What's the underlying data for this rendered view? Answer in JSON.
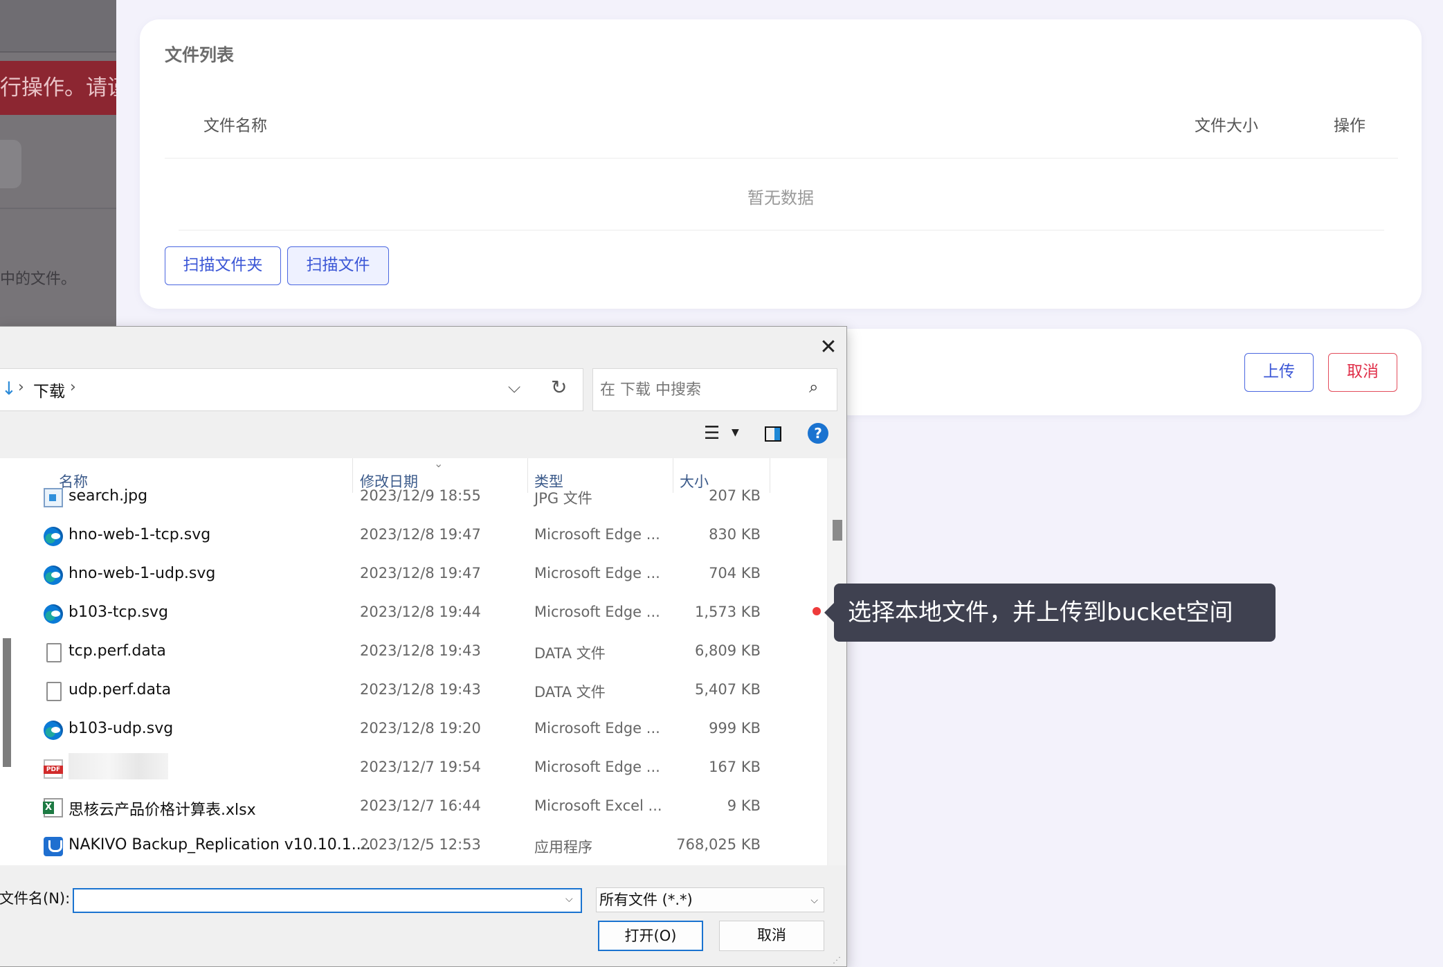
{
  "background": {
    "warning_text": "行操作。请谨",
    "hint_text": "中的文件。"
  },
  "file_list_card": {
    "title": "文件列表",
    "columns": {
      "name": "文件名称",
      "size": "文件大小",
      "operation": "操作"
    },
    "empty_text": "暂无数据",
    "scan_folder_label": "扫描文件夹",
    "scan_file_label": "扫描文件"
  },
  "actions_card": {
    "upload_label": "上传",
    "cancel_label": "取消"
  },
  "dialog": {
    "close_glyph": "✕",
    "breadcrumb": "下载",
    "search_placeholder": "在 下载 中搜索",
    "help_glyph": "?",
    "columns": {
      "name": "名称",
      "date": "修改日期",
      "type": "类型",
      "size": "大小"
    },
    "files": [
      {
        "name": "search.jpg",
        "date": "2023/12/9 18:55",
        "type": "JPG 文件",
        "size": "207 KB",
        "icon": "jpg-file-icon"
      },
      {
        "name": "hno-web-1-tcp.svg",
        "date": "2023/12/8 19:47",
        "type": "Microsoft Edge ...",
        "size": "830 KB",
        "icon": "edge-icon"
      },
      {
        "name": "hno-web-1-udp.svg",
        "date": "2023/12/8 19:47",
        "type": "Microsoft Edge ...",
        "size": "704 KB",
        "icon": "edge-icon"
      },
      {
        "name": "b103-tcp.svg",
        "date": "2023/12/8 19:44",
        "type": "Microsoft Edge ...",
        "size": "1,573 KB",
        "icon": "edge-icon"
      },
      {
        "name": "tcp.perf.data",
        "date": "2023/12/8 19:43",
        "type": "DATA 文件",
        "size": "6,809 KB",
        "icon": "blank-file-icon"
      },
      {
        "name": "udp.perf.data",
        "date": "2023/12/8 19:43",
        "type": "DATA 文件",
        "size": "5,407 KB",
        "icon": "blank-file-icon"
      },
      {
        "name": "b103-udp.svg",
        "date": "2023/12/8 19:20",
        "type": "Microsoft Edge ...",
        "size": "999 KB",
        "icon": "edge-icon"
      },
      {
        "name": "",
        "date": "2023/12/7 19:54",
        "type": "Microsoft Edge ...",
        "size": "167 KB",
        "icon": "pdf-icon"
      },
      {
        "name": "思核云产品价格计算表.xlsx",
        "date": "2023/12/7 16:44",
        "type": "Microsoft Excel ...",
        "size": "9 KB",
        "icon": "excel-icon"
      },
      {
        "name": "NAKIVO Backup_Replication v10.10.1....",
        "date": "2023/12/5 12:53",
        "type": "应用程序",
        "size": "768,025 KB",
        "icon": "installer-icon"
      }
    ],
    "filename_label": "文件名(N):",
    "filename_value": "",
    "filter_value": "所有文件 (*.*)",
    "open_label": "打开(O)",
    "cancel_label": "取消"
  },
  "tooltip": {
    "text": "选择本地文件，并上传到bucket空间"
  }
}
